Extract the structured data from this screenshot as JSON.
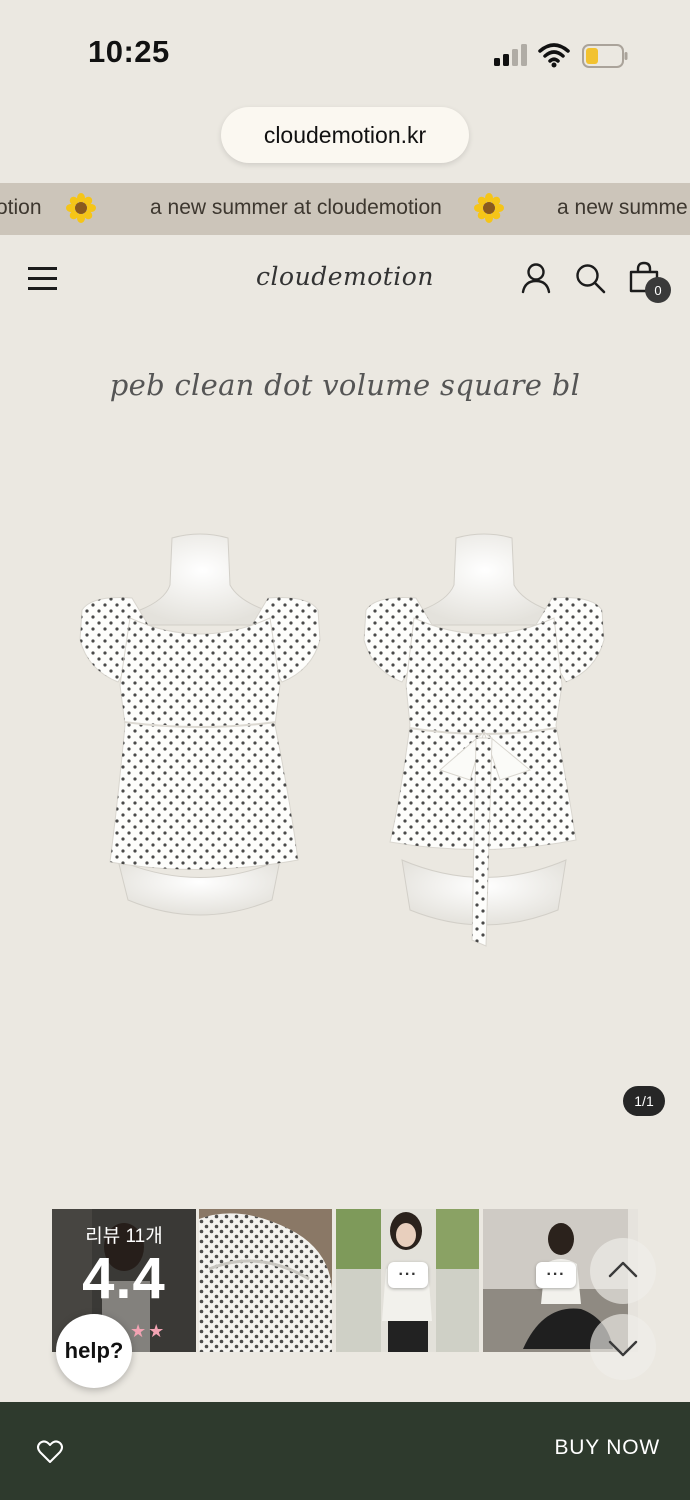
{
  "status_bar": {
    "time": "10:25"
  },
  "browser": {
    "url": "cloudemotion.kr"
  },
  "banner": {
    "text_1": "otion",
    "text_2": "a new summer at cloudemotion",
    "text_3": "a new summe"
  },
  "header": {
    "logo": "cloudemotion",
    "cart_count": "0"
  },
  "product": {
    "title": "peb clean dot volume square bl",
    "page_indicator": "1/1"
  },
  "reviews": {
    "label": "리뷰 11개",
    "score": "4.4",
    "stars": "★★"
  },
  "help": {
    "label": "help?"
  },
  "bottom_bar": {
    "buy_now": "BUY NOW"
  },
  "colors": {
    "bottom_bar": "#2e3a2d",
    "banner": "#ccc5ba",
    "background": "#ebe8e1"
  }
}
